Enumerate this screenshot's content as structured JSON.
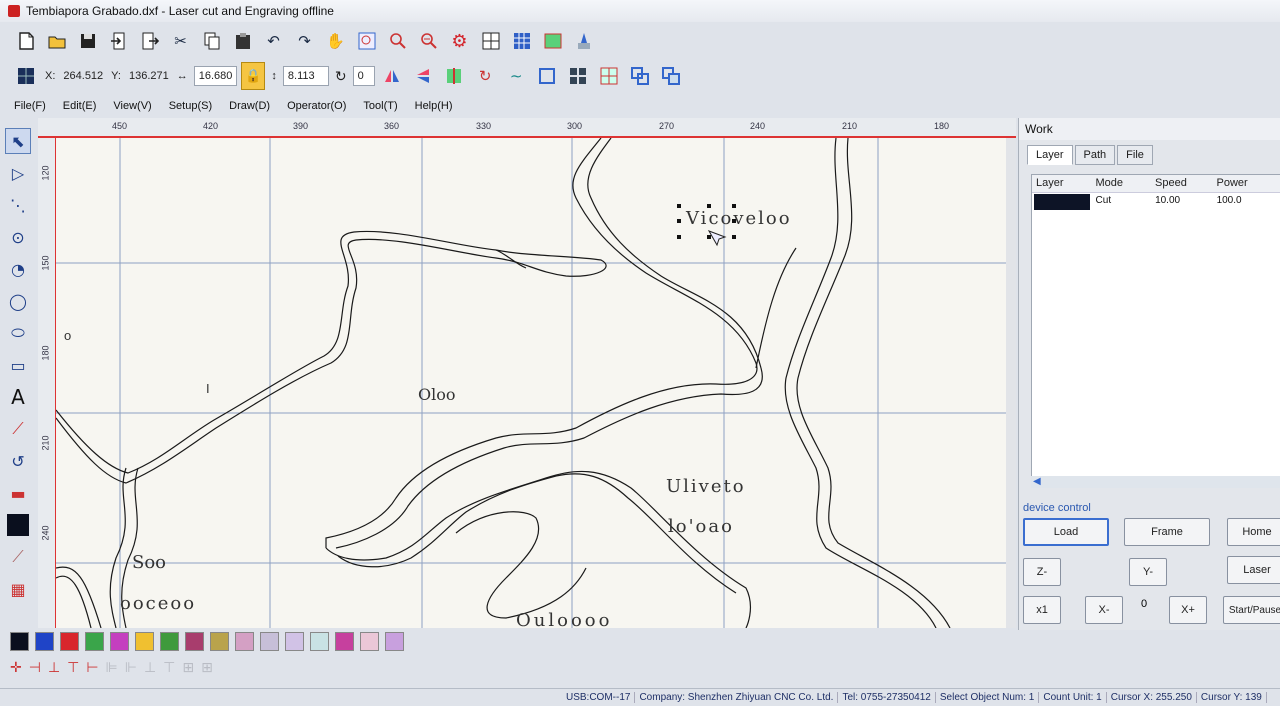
{
  "window": {
    "title": "Tembiapora Grabado.dxf - Laser cut and Engraving offline"
  },
  "toolbar": {
    "icons": [
      "new-icon",
      "open-icon",
      "save-icon",
      "import-icon",
      "export-icon",
      "cut-icon",
      "copy-icon",
      "paste-icon",
      "undo-icon",
      "redo-icon",
      "pan-hand-icon",
      "zoom-window-icon",
      "zoom-in-icon",
      "zoom-out-icon",
      "settings-gear-icon",
      "grid-icon",
      "table-icon",
      "image-icon",
      "pen-tool-icon"
    ]
  },
  "coords": {
    "x_label": "X:",
    "x_value": "264.512",
    "y_label": "Y:",
    "y_value": "136.271",
    "w_label": "↔",
    "w_value": "16.680",
    "h_label": "↕",
    "h_value": "8.113",
    "rot_value": "0"
  },
  "menu": [
    "File(F)",
    "Edit(E)",
    "View(V)",
    "Setup(S)",
    "Draw(D)",
    "Operator(O)",
    "Tool(T)",
    "Help(H)"
  ],
  "ruler": {
    "top": [
      "450",
      "420",
      "390",
      "360",
      "330",
      "300",
      "270",
      "240",
      "210",
      "180"
    ],
    "left": [
      "120",
      "150",
      "180",
      "210",
      "240"
    ]
  },
  "canvas_text": {
    "t1": "Vicoveloo",
    "t2": "Oloo",
    "t3": "Uliveto",
    "t4": "lo'oao",
    "t5": "Soo",
    "t6": "ooceoo",
    "t7": "Ouloooo",
    "t8": "o",
    "t9": "I"
  },
  "panel": {
    "title": "Work",
    "tabs": [
      "Layer",
      "Path",
      "File"
    ],
    "columns": [
      "Layer",
      "Mode",
      "Speed",
      "Power"
    ],
    "rows": [
      {
        "mode": "Cut",
        "speed": "10.00",
        "power": "100.0",
        "color": "#0d1426"
      }
    ],
    "device_label": "device control",
    "buttons": {
      "load": "Load",
      "frame": "Frame",
      "home": "Home",
      "zminus": "Z-",
      "yminus": "Y-",
      "laser": "Laser",
      "x1": "x1",
      "xminus": "X-",
      "zero": "0",
      "xplus": "X+",
      "start": "Start/Pause"
    }
  },
  "palette": [
    "#0a0f1e",
    "#1f44c7",
    "#d8262c",
    "#3aa54a",
    "#c43fbf",
    "#f0c030",
    "#3f9a3c",
    "#a83d6d",
    "#b9a34c",
    "#d4a0c4",
    "#c7bfd8",
    "#d1c2e6",
    "#c9e2e4",
    "#c6409e",
    "#ebc7d7",
    "#c8a0de"
  ],
  "status": {
    "port": "USB:COM--17",
    "company": "Company: Shenzhen Zhiyuan CNC Co. Ltd.",
    "tel": "Tel: 0755-27350412",
    "select": "Select Object Num: 1",
    "count": "Count Unit: 1",
    "cursor_x": "Cursor X: 255.250",
    "cursor_y": "Cursor Y: 139"
  }
}
